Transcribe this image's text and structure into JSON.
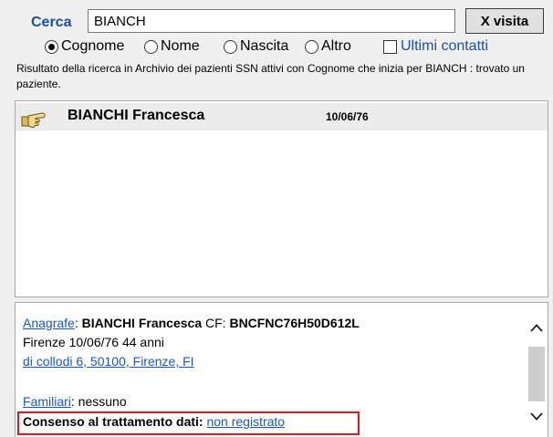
{
  "search": {
    "label": "Cerca",
    "value": "BIANCH",
    "button_label": "X visita"
  },
  "filters": {
    "options": [
      "Cognome",
      "Nome",
      "Nascita",
      "Altro"
    ],
    "selected": "Cognome",
    "recent_contacts_label": "Ultimi contatti",
    "recent_contacts_checked": false
  },
  "result_message": "Risultato della ricerca in Archivio dei pazienti SSN attivi  con Cognome che inizia per BIANCH : trovato un paziente.",
  "patients": [
    {
      "name": "BIANCHI Francesca",
      "dob": "10/06/76",
      "icon": "pointing-hand-icon"
    }
  ],
  "details": {
    "anagrafe_link": "Anagrafe",
    "anagrafe_sep": ": ",
    "full_name": "BIANCHI Francesca",
    "cf_label": " CF: ",
    "cf_value": "BNCFNC76H50D612L",
    "birth_info": "Firenze 10/06/76 44 anni",
    "address_link": "di collodi 6, 50100, Firenze, FI",
    "familiari_link": "Familiari",
    "familiari_sep": ": ",
    "familiari_value": "nessuno",
    "consenso_label": "Consenso al trattamento dati:",
    "consenso_link": "non registrato"
  },
  "colors": {
    "accent_blue": "#1a4fa3",
    "link_blue": "#1a56c9",
    "highlight_red": "#e8131b"
  }
}
